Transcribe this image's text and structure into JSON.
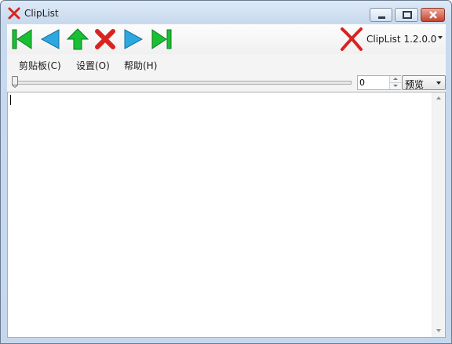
{
  "window": {
    "title": "ClipList",
    "icon": "x-icon"
  },
  "caption_buttons": [
    "minimize-icon",
    "maximize-icon",
    "close-icon"
  ],
  "toolbar": {
    "buttons": [
      "first-icon",
      "previous-icon",
      "up-icon",
      "delete-icon",
      "next-icon",
      "last-icon"
    ],
    "brand_name": "ClipList 1.2.0.0"
  },
  "menu": [
    {
      "label": "剪贴板(C)"
    },
    {
      "label": "设置(O)"
    },
    {
      "label": "帮助(H)"
    }
  ],
  "controls": {
    "spinner_value": "0",
    "view_mode": "预览"
  },
  "colors": {
    "green": "#19c033",
    "blue": "#2ca8e0",
    "red": "#d9231f",
    "title_bg": "#c9daee"
  }
}
